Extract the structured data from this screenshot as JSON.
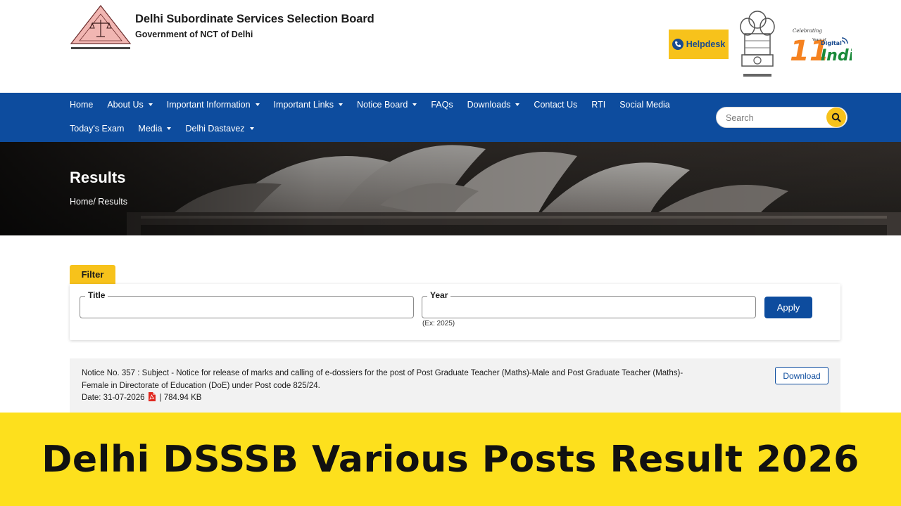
{
  "header": {
    "org_title": "Delhi Subordinate Services Selection Board",
    "org_subtitle": "Government of NCT of Delhi",
    "logo_caption": "(unlabeled)",
    "helpdesk_label": "Helpdesk",
    "emblem_caption": "(unlabeled)",
    "digital_india": {
      "celebrating": "Celebrating",
      "years": "Years of",
      "digital": "Digital",
      "number": "11",
      "india": "India"
    }
  },
  "nav": {
    "row1": [
      {
        "label": "Home",
        "dropdown": false
      },
      {
        "label": "About Us",
        "dropdown": true
      },
      {
        "label": "Important Information",
        "dropdown": true
      },
      {
        "label": "Important Links",
        "dropdown": true
      },
      {
        "label": "Notice Board",
        "dropdown": true
      },
      {
        "label": "FAQs",
        "dropdown": false
      },
      {
        "label": "Downloads",
        "dropdown": true
      },
      {
        "label": "Contact Us",
        "dropdown": false
      },
      {
        "label": "RTI",
        "dropdown": false
      },
      {
        "label": "Social Media",
        "dropdown": false
      }
    ],
    "row2": [
      {
        "label": "Today's Exam",
        "dropdown": false
      },
      {
        "label": "Media",
        "dropdown": true
      },
      {
        "label": "Delhi Dastavez",
        "dropdown": true
      }
    ],
    "search_placeholder": "Search"
  },
  "banner": {
    "title": "Results",
    "breadcrumb": "Home/ Results"
  },
  "filter": {
    "tab_label": "Filter",
    "title_label": "Title",
    "title_value": "",
    "year_label": "Year",
    "year_value": "",
    "year_hint": "(Ex: 2025)",
    "apply_label": "Apply"
  },
  "notice": {
    "text": "Notice No. 357 : Subject - Notice for release of marks and calling of e-dossiers for the post of Post Graduate Teacher (Maths)-Male and Post Graduate Teacher (Maths)-Female in Directorate of Education (DoE) under Post code 825/24.",
    "date": "Date: 31-07-2026",
    "size": "| 784.94 KB",
    "download_label": "Download"
  },
  "promo": {
    "text": "Delhi DSSSB Various Posts Result 2026"
  },
  "colors": {
    "nav_blue": "#0d4c9e",
    "accent_yellow": "#f7c21b",
    "promo_yellow": "#fde01d",
    "logo_pink": "#f1b6b2"
  },
  "icons": {
    "helpdesk": "phone-icon",
    "search": "search-icon",
    "pdf": "pdf-icon",
    "dropdown": "chevron-down-icon"
  }
}
